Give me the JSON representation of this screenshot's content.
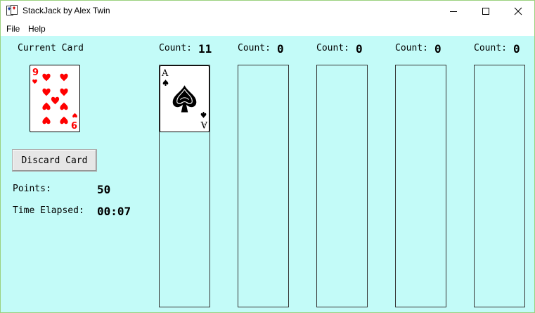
{
  "window": {
    "title": "StackJack by Alex Twin",
    "minimize_icon": "minimize-icon",
    "maximize_icon": "maximize-icon",
    "close_icon": "close-icon"
  },
  "menu": {
    "items": [
      "File",
      "Help"
    ]
  },
  "left_panel": {
    "current_card_label": "Current Card",
    "current_card": {
      "rank": "9",
      "suit": "hearts",
      "color": "#ff0000"
    },
    "discard_button_label": "Discard Card",
    "points_label": "Points:",
    "points_value": "50",
    "time_label": "Time Elapsed:",
    "time_value": "00:07"
  },
  "stacks": [
    {
      "count_label": "Count:",
      "count": "11",
      "top_card": {
        "rank": "A",
        "suit": "spades",
        "color": "#000000"
      }
    },
    {
      "count_label": "Count:",
      "count": "0"
    },
    {
      "count_label": "Count:",
      "count": "0"
    },
    {
      "count_label": "Count:",
      "count": "0"
    },
    {
      "count_label": "Count:",
      "count": "0"
    }
  ],
  "colors": {
    "table_background": "#c3fbf8",
    "window_border": "#9bd17f",
    "heart_red": "#ff0000"
  }
}
